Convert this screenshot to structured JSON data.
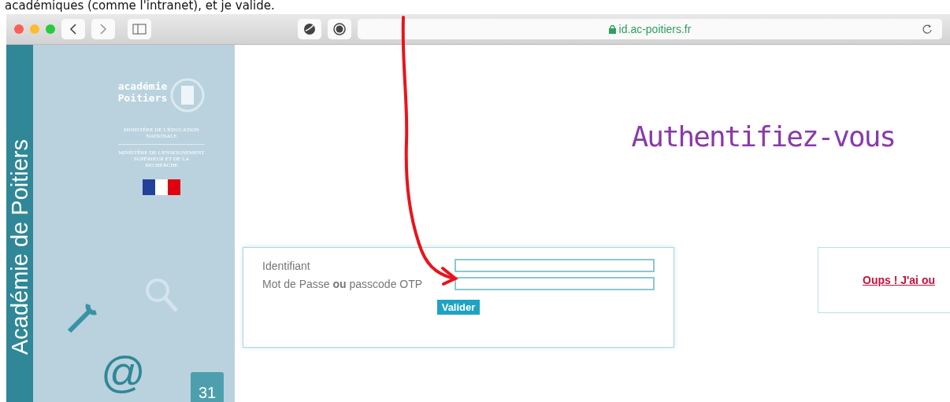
{
  "caption": "académiques (comme l'intranet), et je valide.",
  "browser": {
    "url": "id.ac-poitiers.fr"
  },
  "sidebar": {
    "vertical_title": "Académie de Poitiers",
    "logo_lines": [
      "académie",
      "Poitiers"
    ],
    "ministries": [
      "MINISTÈRE DE L'ÉDUCATION NATIONALE",
      "MINISTÈRE DE L'ENSEIGNEMENT SUPÉRIEUR ET DE LA RECHERCHE"
    ],
    "at_symbol": "@",
    "calendar_day": "31"
  },
  "heading": "Authentifiez-vous",
  "form": {
    "fields": [
      {
        "label": "Identifiant"
      },
      {
        "label": "Mot de Passe **ou** passcode OTP"
      }
    ],
    "submit": "Valider"
  },
  "help_link": "Oups ! J'ai ou"
}
